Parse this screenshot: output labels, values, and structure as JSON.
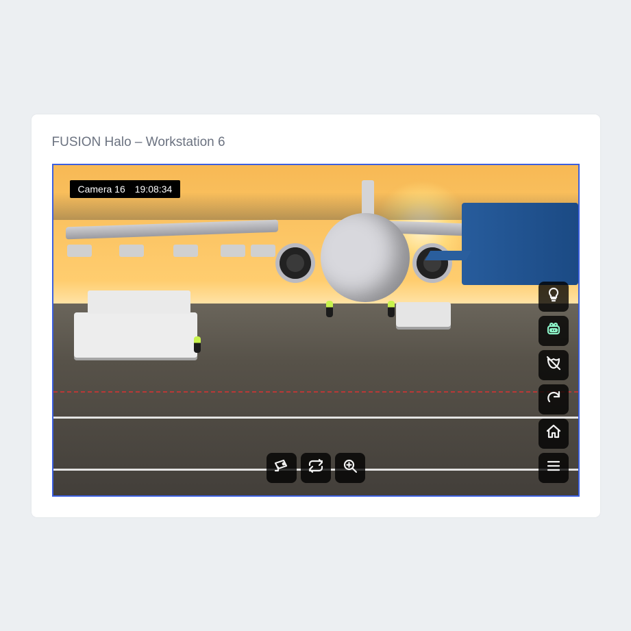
{
  "header": {
    "title": "FUSION Halo – Workstation 6"
  },
  "camera": {
    "label": "Camera 16",
    "time": "19:08:34"
  },
  "controls": {
    "center": [
      {
        "name": "ptz-button",
        "icon": "cctv-icon"
      },
      {
        "name": "cycle-button",
        "icon": "repeat-icon"
      },
      {
        "name": "zoom-button",
        "icon": "zoom-in-icon"
      }
    ],
    "right": [
      {
        "name": "light-button",
        "icon": "lightbulb-icon",
        "active": false
      },
      {
        "name": "aux-button",
        "icon": "aux-icon",
        "active": true
      },
      {
        "name": "mask-button",
        "icon": "mask-off-icon",
        "active": false
      },
      {
        "name": "refresh-button",
        "icon": "refresh-icon",
        "active": false
      },
      {
        "name": "home-button",
        "icon": "home-icon",
        "active": false
      },
      {
        "name": "menu-button",
        "icon": "menu-icon",
        "active": false
      }
    ]
  }
}
